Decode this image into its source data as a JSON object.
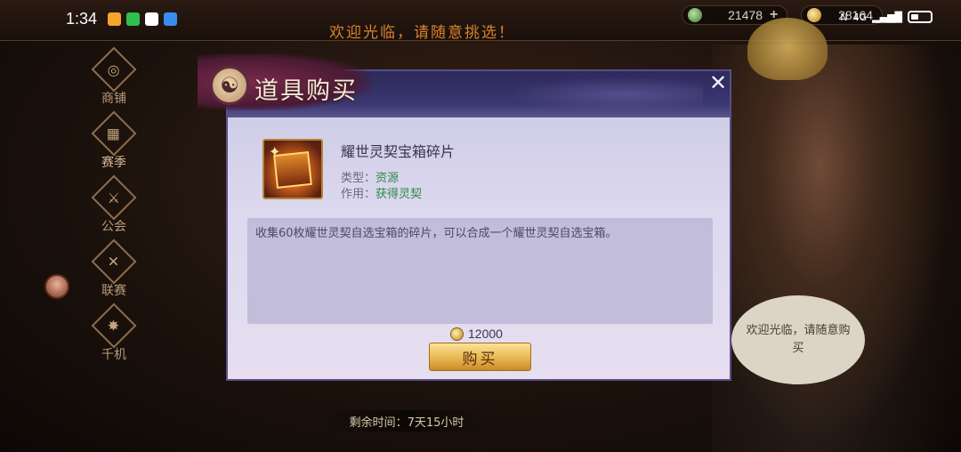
{
  "statusbar": {
    "time": "1:34",
    "network": "4G",
    "apps": [
      {
        "icon": "weibo-icon",
        "color": "#f4a52c"
      },
      {
        "icon": "wechat-icon",
        "color": "#2fbf4f"
      },
      {
        "icon": "qq-icon",
        "color": "#ffffff"
      },
      {
        "icon": "cloud-icon",
        "color": "#3a8df0"
      }
    ]
  },
  "header": {
    "welcome": "欢迎光临，请随意挑选！",
    "jade_amount": "21478",
    "gold_amount": "28164"
  },
  "leftnav": {
    "items": [
      {
        "label": "商铺",
        "glyph": "◎"
      },
      {
        "label": "赛季",
        "glyph": "▦"
      },
      {
        "label": "公会",
        "glyph": "⚔"
      },
      {
        "label": "联赛",
        "glyph": "✕"
      },
      {
        "label": "千机",
        "glyph": "✸"
      }
    ]
  },
  "npc": {
    "speech": "欢迎光临，请随意购买"
  },
  "shop": {
    "remaining_time": "剩余时间：7天15小时"
  },
  "dialog": {
    "title": "道具购买",
    "close": "✕",
    "item": {
      "name": "耀世灵契宝箱碎片",
      "type_label": "类型：",
      "type_value": "资源",
      "use_label": "作用：",
      "use_value": "获得灵契",
      "description": "收集60枚耀世灵契自选宝箱的碎片，可以合成一个耀世灵契自选宝箱。"
    },
    "price": "12000",
    "buy_label": "购买"
  }
}
